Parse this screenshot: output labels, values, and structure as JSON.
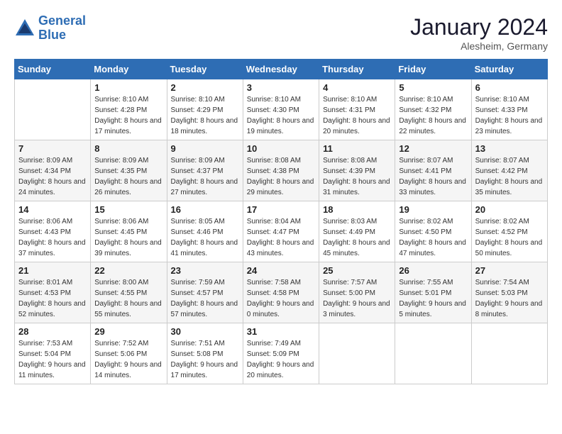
{
  "header": {
    "logo_line1": "General",
    "logo_line2": "Blue",
    "month": "January 2024",
    "location": "Alesheim, Germany"
  },
  "weekdays": [
    "Sunday",
    "Monday",
    "Tuesday",
    "Wednesday",
    "Thursday",
    "Friday",
    "Saturday"
  ],
  "weeks": [
    [
      {
        "day": "",
        "sunrise": "",
        "sunset": "",
        "daylight": ""
      },
      {
        "day": "1",
        "sunrise": "Sunrise: 8:10 AM",
        "sunset": "Sunset: 4:28 PM",
        "daylight": "Daylight: 8 hours and 17 minutes."
      },
      {
        "day": "2",
        "sunrise": "Sunrise: 8:10 AM",
        "sunset": "Sunset: 4:29 PM",
        "daylight": "Daylight: 8 hours and 18 minutes."
      },
      {
        "day": "3",
        "sunrise": "Sunrise: 8:10 AM",
        "sunset": "Sunset: 4:30 PM",
        "daylight": "Daylight: 8 hours and 19 minutes."
      },
      {
        "day": "4",
        "sunrise": "Sunrise: 8:10 AM",
        "sunset": "Sunset: 4:31 PM",
        "daylight": "Daylight: 8 hours and 20 minutes."
      },
      {
        "day": "5",
        "sunrise": "Sunrise: 8:10 AM",
        "sunset": "Sunset: 4:32 PM",
        "daylight": "Daylight: 8 hours and 22 minutes."
      },
      {
        "day": "6",
        "sunrise": "Sunrise: 8:10 AM",
        "sunset": "Sunset: 4:33 PM",
        "daylight": "Daylight: 8 hours and 23 minutes."
      }
    ],
    [
      {
        "day": "7",
        "sunrise": "Sunrise: 8:09 AM",
        "sunset": "Sunset: 4:34 PM",
        "daylight": "Daylight: 8 hours and 24 minutes."
      },
      {
        "day": "8",
        "sunrise": "Sunrise: 8:09 AM",
        "sunset": "Sunset: 4:35 PM",
        "daylight": "Daylight: 8 hours and 26 minutes."
      },
      {
        "day": "9",
        "sunrise": "Sunrise: 8:09 AM",
        "sunset": "Sunset: 4:37 PM",
        "daylight": "Daylight: 8 hours and 27 minutes."
      },
      {
        "day": "10",
        "sunrise": "Sunrise: 8:08 AM",
        "sunset": "Sunset: 4:38 PM",
        "daylight": "Daylight: 8 hours and 29 minutes."
      },
      {
        "day": "11",
        "sunrise": "Sunrise: 8:08 AM",
        "sunset": "Sunset: 4:39 PM",
        "daylight": "Daylight: 8 hours and 31 minutes."
      },
      {
        "day": "12",
        "sunrise": "Sunrise: 8:07 AM",
        "sunset": "Sunset: 4:41 PM",
        "daylight": "Daylight: 8 hours and 33 minutes."
      },
      {
        "day": "13",
        "sunrise": "Sunrise: 8:07 AM",
        "sunset": "Sunset: 4:42 PM",
        "daylight": "Daylight: 8 hours and 35 minutes."
      }
    ],
    [
      {
        "day": "14",
        "sunrise": "Sunrise: 8:06 AM",
        "sunset": "Sunset: 4:43 PM",
        "daylight": "Daylight: 8 hours and 37 minutes."
      },
      {
        "day": "15",
        "sunrise": "Sunrise: 8:06 AM",
        "sunset": "Sunset: 4:45 PM",
        "daylight": "Daylight: 8 hours and 39 minutes."
      },
      {
        "day": "16",
        "sunrise": "Sunrise: 8:05 AM",
        "sunset": "Sunset: 4:46 PM",
        "daylight": "Daylight: 8 hours and 41 minutes."
      },
      {
        "day": "17",
        "sunrise": "Sunrise: 8:04 AM",
        "sunset": "Sunset: 4:47 PM",
        "daylight": "Daylight: 8 hours and 43 minutes."
      },
      {
        "day": "18",
        "sunrise": "Sunrise: 8:03 AM",
        "sunset": "Sunset: 4:49 PM",
        "daylight": "Daylight: 8 hours and 45 minutes."
      },
      {
        "day": "19",
        "sunrise": "Sunrise: 8:02 AM",
        "sunset": "Sunset: 4:50 PM",
        "daylight": "Daylight: 8 hours and 47 minutes."
      },
      {
        "day": "20",
        "sunrise": "Sunrise: 8:02 AM",
        "sunset": "Sunset: 4:52 PM",
        "daylight": "Daylight: 8 hours and 50 minutes."
      }
    ],
    [
      {
        "day": "21",
        "sunrise": "Sunrise: 8:01 AM",
        "sunset": "Sunset: 4:53 PM",
        "daylight": "Daylight: 8 hours and 52 minutes."
      },
      {
        "day": "22",
        "sunrise": "Sunrise: 8:00 AM",
        "sunset": "Sunset: 4:55 PM",
        "daylight": "Daylight: 8 hours and 55 minutes."
      },
      {
        "day": "23",
        "sunrise": "Sunrise: 7:59 AM",
        "sunset": "Sunset: 4:57 PM",
        "daylight": "Daylight: 8 hours and 57 minutes."
      },
      {
        "day": "24",
        "sunrise": "Sunrise: 7:58 AM",
        "sunset": "Sunset: 4:58 PM",
        "daylight": "Daylight: 9 hours and 0 minutes."
      },
      {
        "day": "25",
        "sunrise": "Sunrise: 7:57 AM",
        "sunset": "Sunset: 5:00 PM",
        "daylight": "Daylight: 9 hours and 3 minutes."
      },
      {
        "day": "26",
        "sunrise": "Sunrise: 7:55 AM",
        "sunset": "Sunset: 5:01 PM",
        "daylight": "Daylight: 9 hours and 5 minutes."
      },
      {
        "day": "27",
        "sunrise": "Sunrise: 7:54 AM",
        "sunset": "Sunset: 5:03 PM",
        "daylight": "Daylight: 9 hours and 8 minutes."
      }
    ],
    [
      {
        "day": "28",
        "sunrise": "Sunrise: 7:53 AM",
        "sunset": "Sunset: 5:04 PM",
        "daylight": "Daylight: 9 hours and 11 minutes."
      },
      {
        "day": "29",
        "sunrise": "Sunrise: 7:52 AM",
        "sunset": "Sunset: 5:06 PM",
        "daylight": "Daylight: 9 hours and 14 minutes."
      },
      {
        "day": "30",
        "sunrise": "Sunrise: 7:51 AM",
        "sunset": "Sunset: 5:08 PM",
        "daylight": "Daylight: 9 hours and 17 minutes."
      },
      {
        "day": "31",
        "sunrise": "Sunrise: 7:49 AM",
        "sunset": "Sunset: 5:09 PM",
        "daylight": "Daylight: 9 hours and 20 minutes."
      },
      {
        "day": "",
        "sunrise": "",
        "sunset": "",
        "daylight": ""
      },
      {
        "day": "",
        "sunrise": "",
        "sunset": "",
        "daylight": ""
      },
      {
        "day": "",
        "sunrise": "",
        "sunset": "",
        "daylight": ""
      }
    ]
  ]
}
